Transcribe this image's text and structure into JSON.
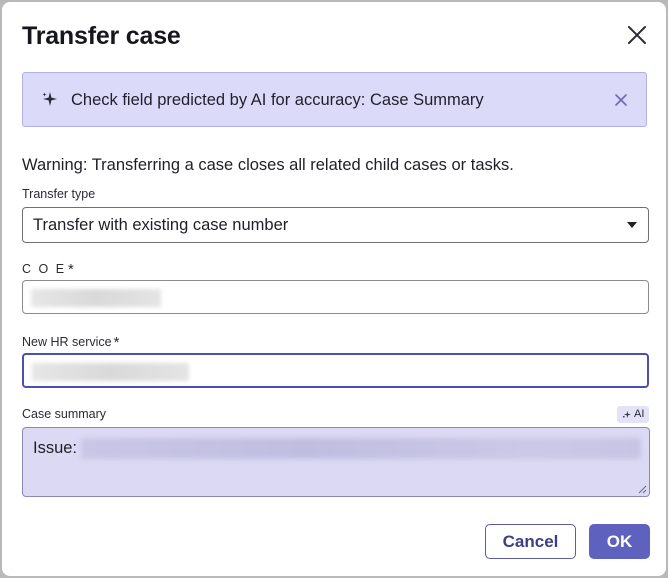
{
  "dialog": {
    "title": "Transfer case",
    "close_icon": "close-icon"
  },
  "banner": {
    "icon": "ai-sparkle-icon",
    "message": "Check field predicted by AI for accuracy: Case Summary",
    "dismiss_icon": "close-icon"
  },
  "warning": "Warning: Transferring a case closes all related child cases or tasks.",
  "fields": {
    "transfer_type": {
      "label": "Transfer type",
      "value": "Transfer with existing case number"
    },
    "coe": {
      "label": "C O E",
      "required_mark": "*",
      "value": ""
    },
    "hr_service": {
      "label": "New HR service",
      "required_mark": "*",
      "value": ""
    },
    "case_summary": {
      "label": "Case summary",
      "ai_badge": "AI",
      "prefix": "Issue:"
    }
  },
  "buttons": {
    "cancel": "Cancel",
    "ok": "OK"
  },
  "colors": {
    "accent": "#5e62be",
    "banner_bg": "#dbdaf8",
    "ai_field_bg": "#dbd9f4"
  }
}
